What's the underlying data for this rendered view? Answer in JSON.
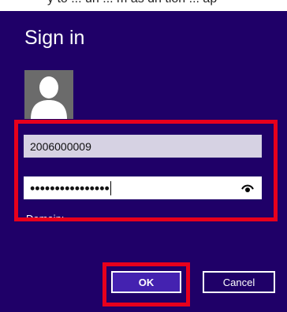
{
  "header": {
    "partial_text": "y to ... un ... m as dn tion ... ap"
  },
  "dialog": {
    "title": "Sign in",
    "username_value": "2006000009",
    "password_masked": "••••••••••••••••",
    "domain_label": "Domain:",
    "ok_label": "OK",
    "cancel_label": "Cancel"
  },
  "icons": {
    "avatar": "user-silhouette-icon",
    "reveal": "eye-icon"
  },
  "colors": {
    "background": "#1f0068",
    "ok_button": "#4422b0",
    "username_field": "#d6d2e3",
    "highlight": "#e8001c"
  }
}
